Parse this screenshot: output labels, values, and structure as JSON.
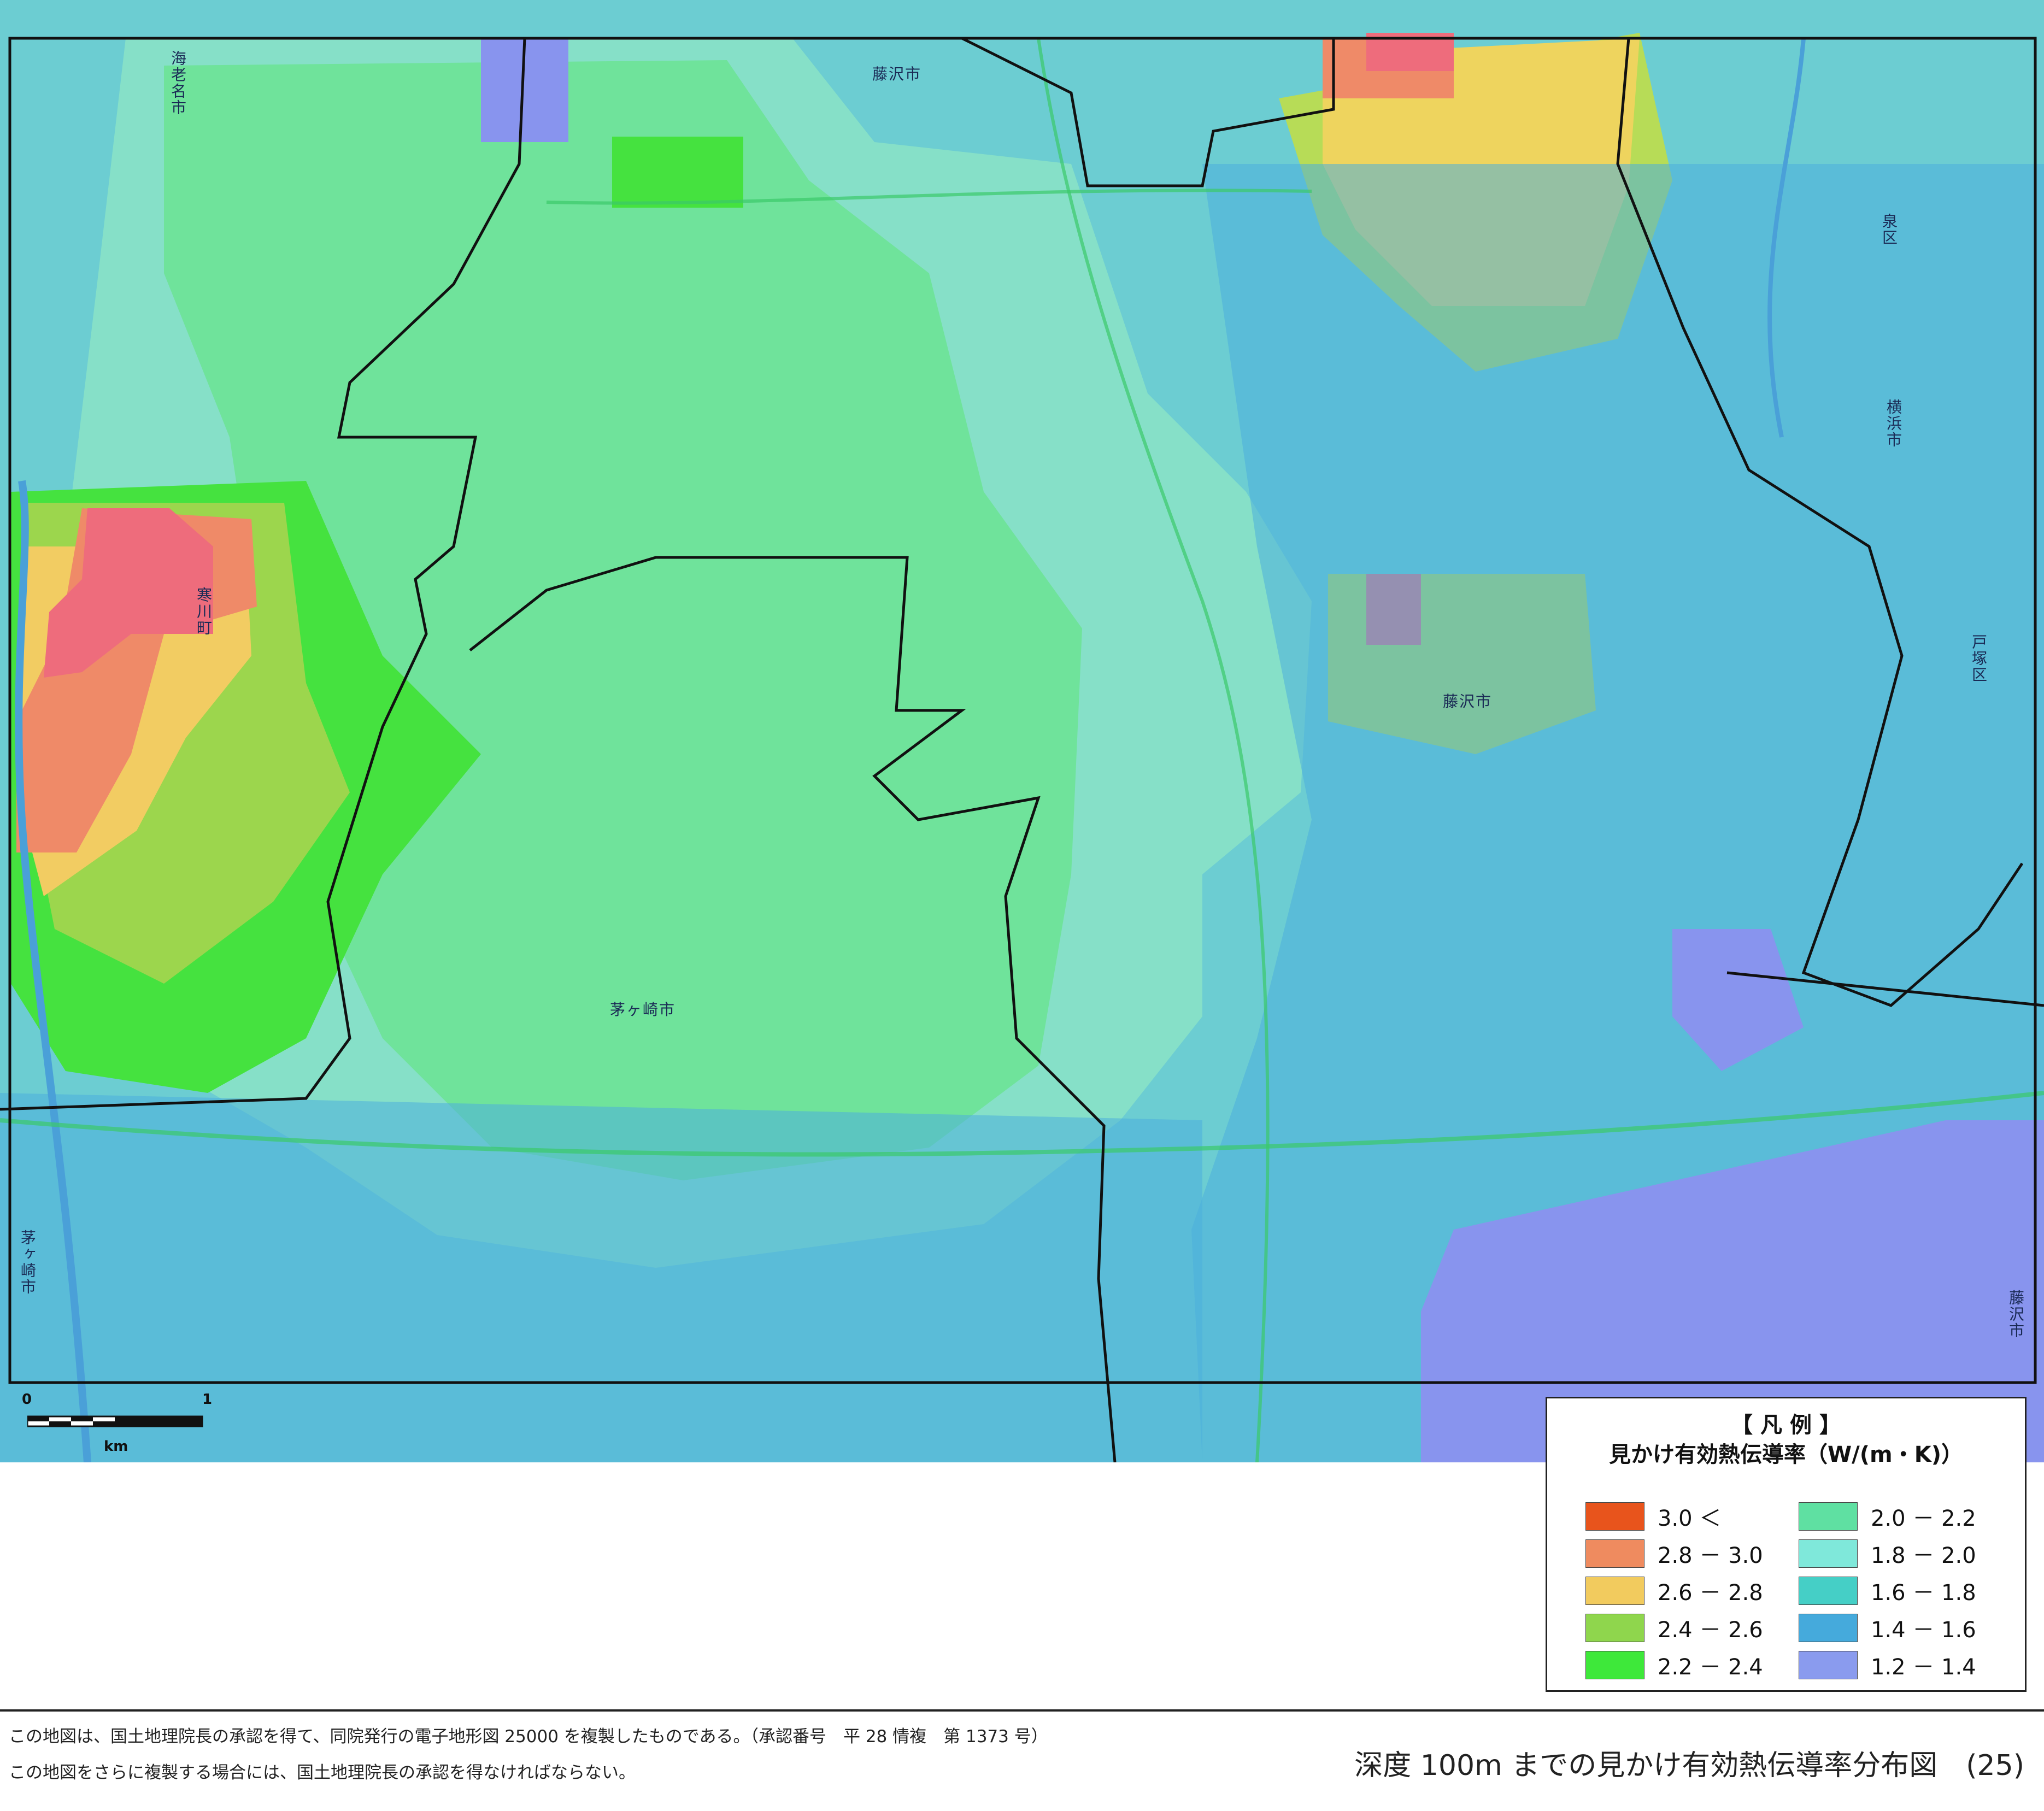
{
  "map": {
    "labels": {
      "ebina": "海老名市",
      "fujisawa_top": "藤沢市",
      "izumi": "泉区",
      "yokohama": "横浜市",
      "samukawa": "寒川町",
      "fujisawa_mid": "藤沢市",
      "totsuka": "戸塚区",
      "chigasaki": "茅ヶ崎市",
      "chigasaki_left": "茅ヶ崎市",
      "fujisawa_right": "藤沢市"
    },
    "scale": {
      "zero": "0",
      "one": "1",
      "unit": "km"
    },
    "colors": {
      "water": "#4aa0d8",
      "boundary": "#111111"
    }
  },
  "legend": {
    "heading": "【 凡 例 】",
    "title": "見かけ有効熱伝導率（W/(m・K)）",
    "items": [
      {
        "label": "3.0 ＜",
        "color": "#e8541c"
      },
      {
        "label": "2.8 － 3.0",
        "color": "#ef8b5f"
      },
      {
        "label": "2.6 － 2.8",
        "color": "#f2cb5e"
      },
      {
        "label": "2.4 － 2.6",
        "color": "#8fd64d"
      },
      {
        "label": "2.2 － 2.4",
        "color": "#3ee83a"
      },
      {
        "label": "2.0 － 2.2",
        "color": "#5fe0a2"
      },
      {
        "label": "1.8 － 2.0",
        "color": "#7fe8da"
      },
      {
        "label": "1.6 － 1.8",
        "color": "#45cfc6"
      },
      {
        "label": "1.4 － 1.6",
        "color": "#45aadc"
      },
      {
        "label": "1.2 － 1.4",
        "color": "#8a9bee"
      }
    ]
  },
  "footer": {
    "note1": "この地図は、国土地理院長の承認を得て、同院発行の電子地形図 25000 を複製したものである。（承認番号　平 28 情複　第 1373 号）",
    "note2": "この地図をさらに複製する場合には、国土地理院長の承認を得なければならない。",
    "title": "深度 100m までの見かけ有効熱伝導率分布図　(25)"
  }
}
